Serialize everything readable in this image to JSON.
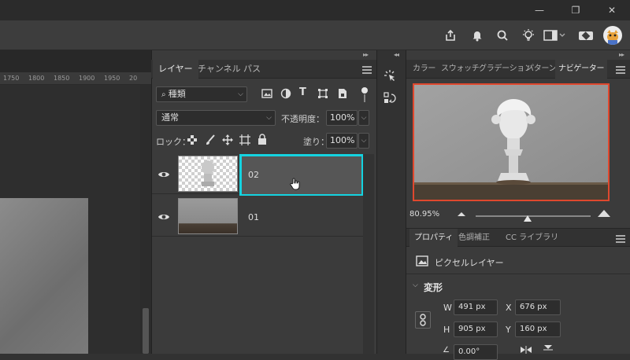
{
  "titlebar": {
    "minimize": "—",
    "restore": "❐",
    "close": "✕"
  },
  "ruler": {
    "ticks": [
      "1750",
      "1800",
      "1850",
      "1900",
      "1950",
      "20"
    ]
  },
  "layers_panel": {
    "tabs": [
      "レイヤー",
      "チャンネル",
      "パス"
    ],
    "filter": {
      "value": "種類"
    },
    "blend_mode": {
      "value": "通常"
    },
    "opacity": {
      "label": "不透明度：",
      "value": "100%"
    },
    "lock": {
      "label": "ロック："
    },
    "fill": {
      "label": "塗り：",
      "value": "100%"
    },
    "layers": [
      {
        "name": "02",
        "selected": true
      },
      {
        "name": "01",
        "selected": false
      }
    ],
    "highlight_color": "#14d3e0"
  },
  "navigator_panel": {
    "tabs": [
      "カラー",
      "スウォッチ",
      "グラデーション",
      "パターン",
      "ナビゲーター"
    ],
    "zoom": "80.95%",
    "zoom_slider_level": 0.45,
    "view_box_color": "#e0482e"
  },
  "properties_panel": {
    "tabs": [
      "プロパティ",
      "色調補正",
      "CC ライブラリ"
    ],
    "layer_type": "ピクセルレイヤー",
    "section_title": "変形",
    "w": {
      "label": "W",
      "value": "491 px"
    },
    "h": {
      "label": "H",
      "value": "905 px"
    },
    "x": {
      "label": "X",
      "value": "676 px"
    },
    "y": {
      "label": "Y",
      "value": "160 px"
    },
    "angle": {
      "value": "0.00°"
    }
  },
  "icons": [
    "share-icon",
    "bell-icon",
    "search-icon",
    "lightbulb-icon",
    "workspace-icon",
    "plugin-icon",
    "avatar"
  ]
}
